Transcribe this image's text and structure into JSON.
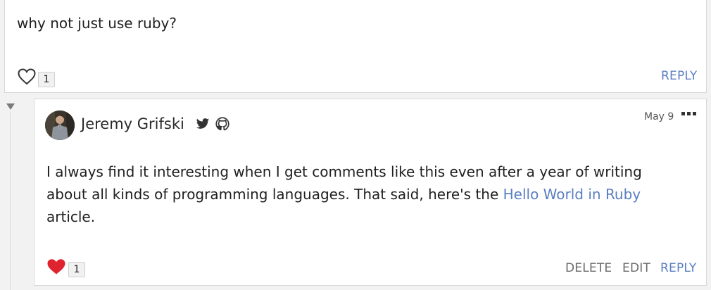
{
  "parent_comment": {
    "body": "why not just use ruby?",
    "like_count": "1",
    "reply_label": "REPLY"
  },
  "child_comment": {
    "author": "Jeremy Grifski",
    "date": "May 9",
    "body_before_link": "I always find it interesting when I get comments like this even after a year of writing about all kinds of programming languages. That said, here's the ",
    "link_text": "Hello World in Ruby",
    "body_after_link": " article.",
    "like_count": "1",
    "delete_label": "DELETE",
    "edit_label": "EDIT",
    "reply_label": "REPLY"
  },
  "icons": {
    "parent_like": "heart-outline-icon",
    "child_like": "heart-filled-icon",
    "twitter": "twitter-icon",
    "github": "github-icon",
    "collapse": "collapse-triangle-icon",
    "more": "more-options-icon"
  },
  "colors": {
    "link": "#5a7fc0",
    "heart_filled": "#e0242f",
    "muted_action": "#6b6b6b"
  }
}
